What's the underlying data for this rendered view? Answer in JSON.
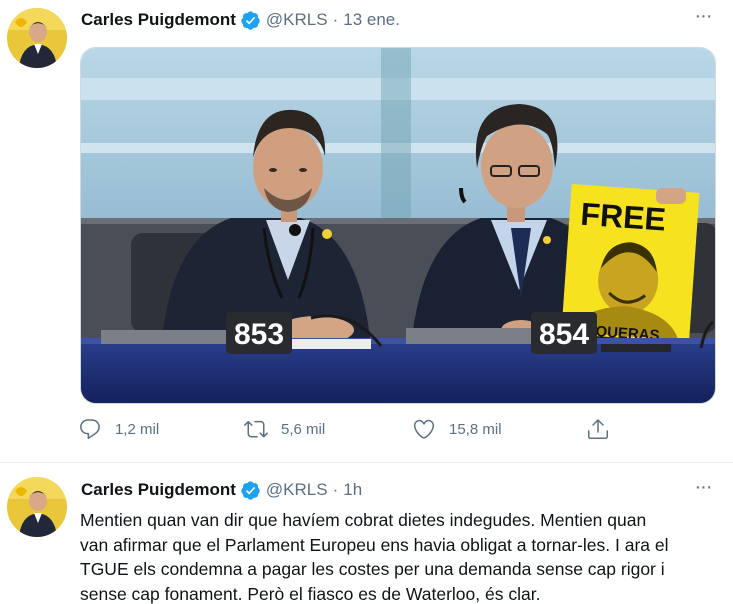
{
  "tweets": [
    {
      "author": "Carles Puigdemont",
      "handle": "@KRLS",
      "separator": "·",
      "time": "13 ene.",
      "more": "···",
      "media": {
        "seat_left": "853",
        "seat_right": "854",
        "sign_top": "FREE",
        "sign_bottom": "JUNQUERAS"
      },
      "stats": {
        "replies": "1,2 mil",
        "retweets": "5,6 mil",
        "likes": "15,8 mil"
      }
    },
    {
      "author": "Carles Puigdemont",
      "handle": "@KRLS",
      "separator": "·",
      "time": "1h",
      "more": "···",
      "text": [
        "Mentien quan van dir que havíem cobrat dietes indegudes. Mentien quan",
        "van afirmar que el Parlament Europeu ens havia obligat a tornar-les. I ara el",
        "TGUE els condemna a pagar les costes per una demanda sense cap rigor i",
        "sense cap fonament. Però el fiasco es de Waterloo, és clar."
      ]
    }
  ],
  "colors": {
    "verified": "#1da1f2",
    "secondary_text": "#5b7083",
    "sign_yellow": "#f7e21f"
  }
}
